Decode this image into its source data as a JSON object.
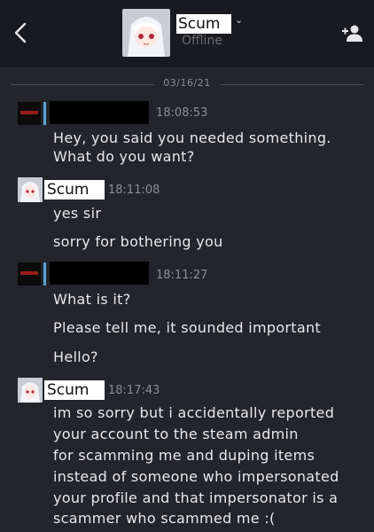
{
  "header": {
    "contact_name": "Scum",
    "status": "Offline"
  },
  "date_divider": "03/16/21",
  "messages": [
    {
      "sender": "",
      "time": "18:08:53",
      "lines": [
        "Hey, you said you needed something.",
        "What do you want?"
      ]
    },
    {
      "sender": "Scum",
      "time": "18:11:08",
      "lines": [
        "yes sir",
        "sorry for bothering you"
      ]
    },
    {
      "sender": "",
      "time": "18:11:27",
      "lines": [
        "What is it?",
        "Please tell me, it sounded important",
        "Hello?"
      ]
    },
    {
      "sender": "Scum",
      "time": "18:17:43",
      "lines": [
        "im so sorry but i accidentally reported",
        "your account to the steam admin",
        "for scamming me and duping items",
        "instead of someone who impersonated",
        "your profile and that impersonator is a",
        "scammer who scammed me :("
      ]
    }
  ],
  "colors": {
    "background": "#23252b",
    "header": "#181a1f",
    "timestamp": "#8c8e93",
    "text": "#e8e8ea",
    "accent_bar": "#5aa3d6"
  }
}
